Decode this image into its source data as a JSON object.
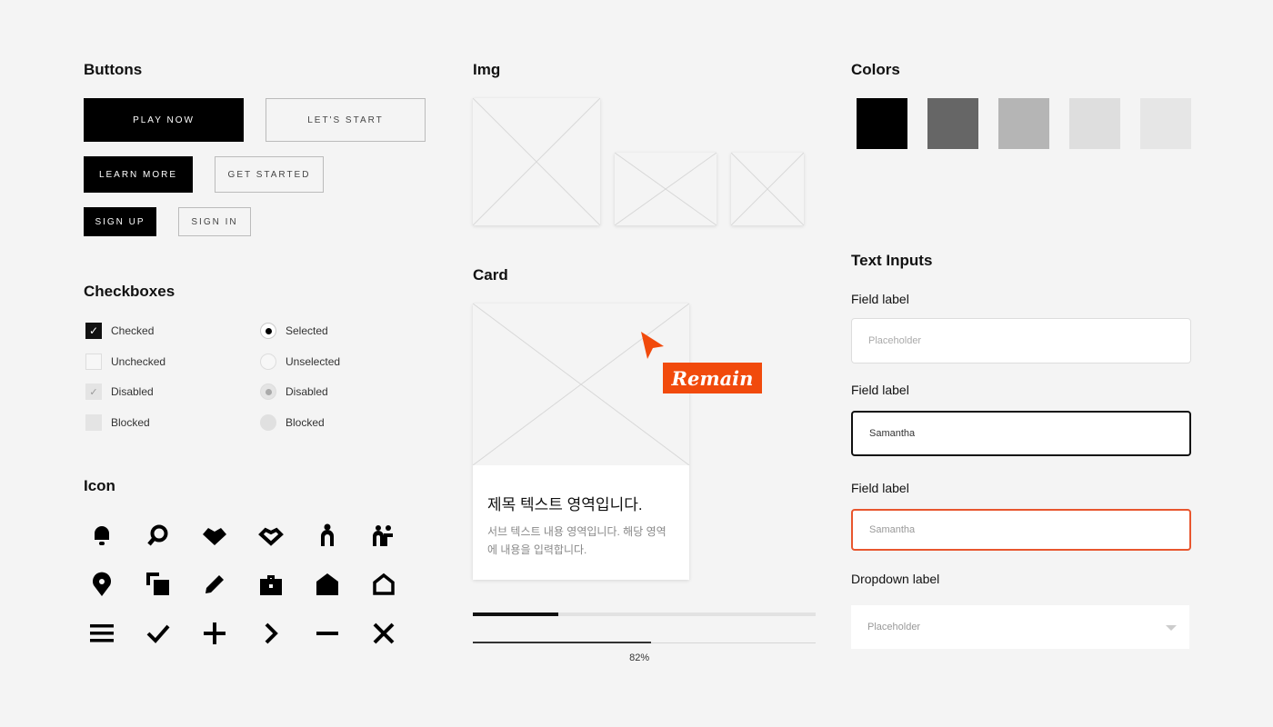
{
  "buttons": {
    "title": "Buttons",
    "play_now": "PLAY NOW",
    "lets_start": "LET'S START",
    "learn_more": "LEARN MORE",
    "get_started": "GET STARTED",
    "sign_up": "SIGN UP",
    "sign_in": "SIGN IN"
  },
  "checkboxes": {
    "title": "Checkboxes",
    "checkbox_labels": [
      "Checked",
      "Unchecked",
      "Disabled",
      "Blocked"
    ],
    "radio_labels": [
      "Selected",
      "Unselected",
      "Disabled",
      "Blocked"
    ]
  },
  "icon_section": {
    "title": "Icon",
    "icons": [
      "bell-icon",
      "search-icon",
      "heart-filled-icon",
      "heart-outline-icon",
      "person-icon",
      "people-icon",
      "map-pin-icon",
      "copy-icon",
      "pencil-icon",
      "briefcase-icon",
      "home-filled-icon",
      "home-outline-icon",
      "menu-icon",
      "check-icon",
      "plus-icon",
      "chevron-right-icon",
      "minus-icon",
      "close-icon"
    ]
  },
  "img_section": {
    "title": "Img"
  },
  "card_section": {
    "title": "Card",
    "card_title": "제목 텍스트 영역입니다.",
    "card_sub": "서브 텍스트 내용 영역입니다. 해당 영역에 내용을 입력합니다.",
    "badge": "Remain"
  },
  "progress": {
    "bar1_fraction": 0.25,
    "bar2_fraction": 0.82,
    "bar2_label": "82%"
  },
  "colors": {
    "title": "Colors",
    "swatches": [
      "#000000",
      "#666666",
      "#b5b5b5",
      "#dedede",
      "#e6e6e6"
    ],
    "accent": "#f14a0c",
    "error": "#e8562e"
  },
  "text_inputs": {
    "title": "Text Inputs",
    "field1_label": "Field label",
    "field1_placeholder": "Placeholder",
    "field2_label": "Field label",
    "field2_value": "Samantha",
    "field3_label": "Field label",
    "field3_value": "Samantha",
    "dropdown_label": "Dropdown label",
    "dropdown_placeholder": "Placeholder"
  }
}
